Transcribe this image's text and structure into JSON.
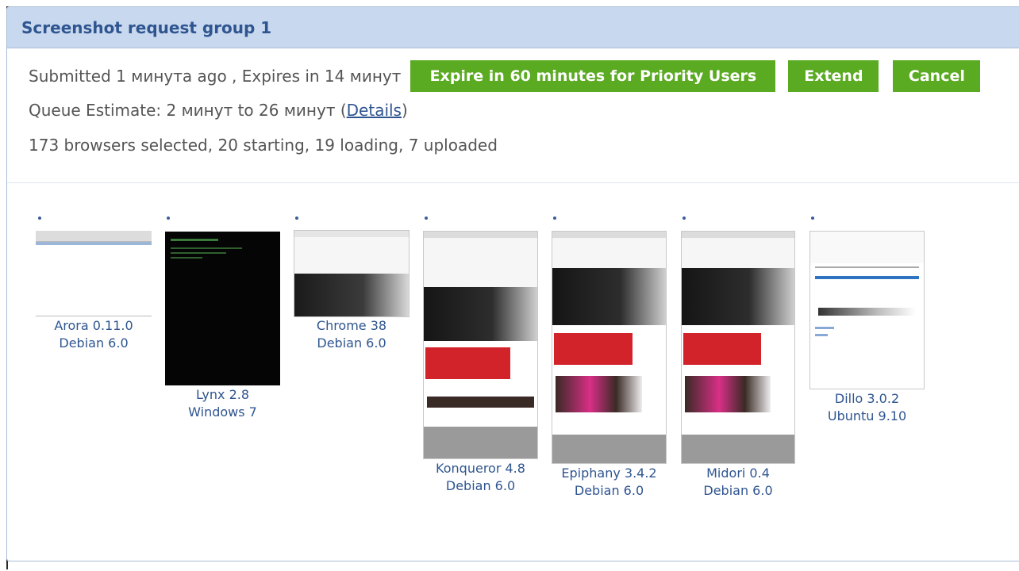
{
  "group": {
    "title": "Screenshot request group 1",
    "submitted_text": "Submitted 1 минута ago , Expires in 14 минут",
    "expire_button": "Expire in 60 minutes for Priority Users",
    "extend_button": "Extend",
    "cancel_button": "Cancel",
    "queue_prefix": "Queue Estimate: 2 минут to 26 минут (",
    "details_link": "Details",
    "queue_suffix": ")",
    "status_text": "173 browsers selected, 20 starting, 19 loading, 7 uploaded"
  },
  "screenshots": [
    {
      "browser": "Arora 0.11.0",
      "os": "Debian 6.0"
    },
    {
      "browser": "Lynx 2.8",
      "os": "Windows 7"
    },
    {
      "browser": "Chrome 38",
      "os": "Debian 6.0"
    },
    {
      "browser": "Konqueror 4.8",
      "os": "Debian 6.0"
    },
    {
      "browser": "Epiphany 3.4.2",
      "os": "Debian 6.0"
    },
    {
      "browser": "Midori 0.4",
      "os": "Debian 6.0"
    },
    {
      "browser": "Dillo 3.0.2",
      "os": "Ubuntu 9.10"
    }
  ],
  "colors": {
    "header_bg": "#c8d8ee",
    "title": "#2f5590",
    "button": "#5aaa22",
    "thumb_red": "#d2232a"
  }
}
